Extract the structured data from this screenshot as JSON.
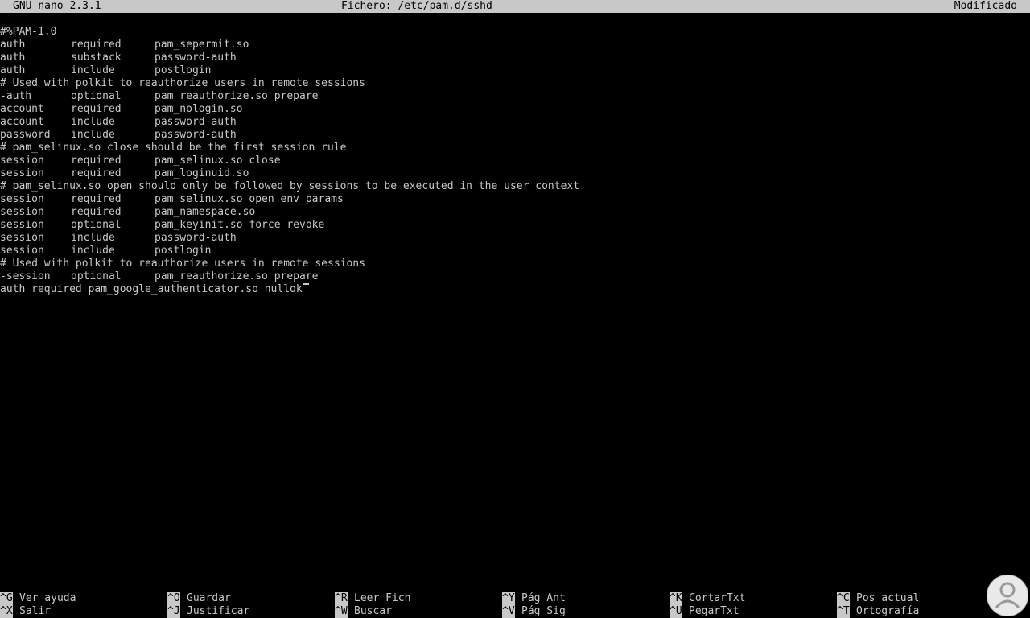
{
  "titlebar": {
    "version": "GNU nano 2.3.1",
    "file": "Fichero: /etc/pam.d/sshd",
    "status": "Modificado"
  },
  "editor": {
    "lines": [
      {
        "full": "#%PAM-1.0"
      },
      {
        "c1": "auth",
        "c2": "required",
        "c3": "pam_sepermit.so"
      },
      {
        "c1": "auth",
        "c2": "substack",
        "c3": "password-auth"
      },
      {
        "c1": "auth",
        "c2": "include",
        "c3": "postlogin"
      },
      {
        "full": "# Used with polkit to reauthorize users in remote sessions"
      },
      {
        "c1": "-auth",
        "c2": "optional",
        "c3": "pam_reauthorize.so prepare"
      },
      {
        "c1": "account",
        "c2": "required",
        "c3": "pam_nologin.so"
      },
      {
        "c1": "account",
        "c2": "include",
        "c3": "password-auth"
      },
      {
        "c1": "password",
        "c2": "include",
        "c3": "password-auth"
      },
      {
        "full": "# pam_selinux.so close should be the first session rule"
      },
      {
        "c1": "session",
        "c2": "required",
        "c3": "pam_selinux.so close"
      },
      {
        "c1": "session",
        "c2": "required",
        "c3": "pam_loginuid.so"
      },
      {
        "full": "# pam_selinux.so open should only be followed by sessions to be executed in the user context"
      },
      {
        "c1": "session",
        "c2": "required",
        "c3": "pam_selinux.so open env_params"
      },
      {
        "c1": "session",
        "c2": "required",
        "c3": "pam_namespace.so"
      },
      {
        "c1": "session",
        "c2": "optional",
        "c3": "pam_keyinit.so force revoke"
      },
      {
        "c1": "session",
        "c2": "include",
        "c3": "password-auth"
      },
      {
        "c1": "session",
        "c2": "include",
        "c3": "postlogin"
      },
      {
        "full": "# Used with polkit to reauthorize users in remote sessions"
      },
      {
        "c1": "-session",
        "c2": "optional",
        "c3": "pam_reauthorize.so prepare"
      },
      {
        "full": "auth required pam_google_authenticator.so nullok"
      }
    ]
  },
  "shortcuts": {
    "row1": [
      {
        "key": "^G",
        "label": "Ver ayuda"
      },
      {
        "key": "^O",
        "label": "Guardar"
      },
      {
        "key": "^R",
        "label": "Leer Fich"
      },
      {
        "key": "^Y",
        "label": "Pág Ant"
      },
      {
        "key": "^K",
        "label": "CortarTxt"
      },
      {
        "key": "^C",
        "label": "Pos actual"
      }
    ],
    "row2": [
      {
        "key": "^X",
        "label": "Salir"
      },
      {
        "key": "^J",
        "label": "Justificar"
      },
      {
        "key": "^W",
        "label": "Buscar"
      },
      {
        "key": "^V",
        "label": "Pág Sig"
      },
      {
        "key": "^U",
        "label": "PegarTxt"
      },
      {
        "key": "^T",
        "label": "Ortografía"
      }
    ]
  },
  "colors": {
    "background": "#000000",
    "foreground": "#c8c8c8",
    "inverse_bg": "#c8c8c8",
    "inverse_fg": "#000000"
  },
  "watermark": {
    "icon": "user-circle-icon"
  }
}
